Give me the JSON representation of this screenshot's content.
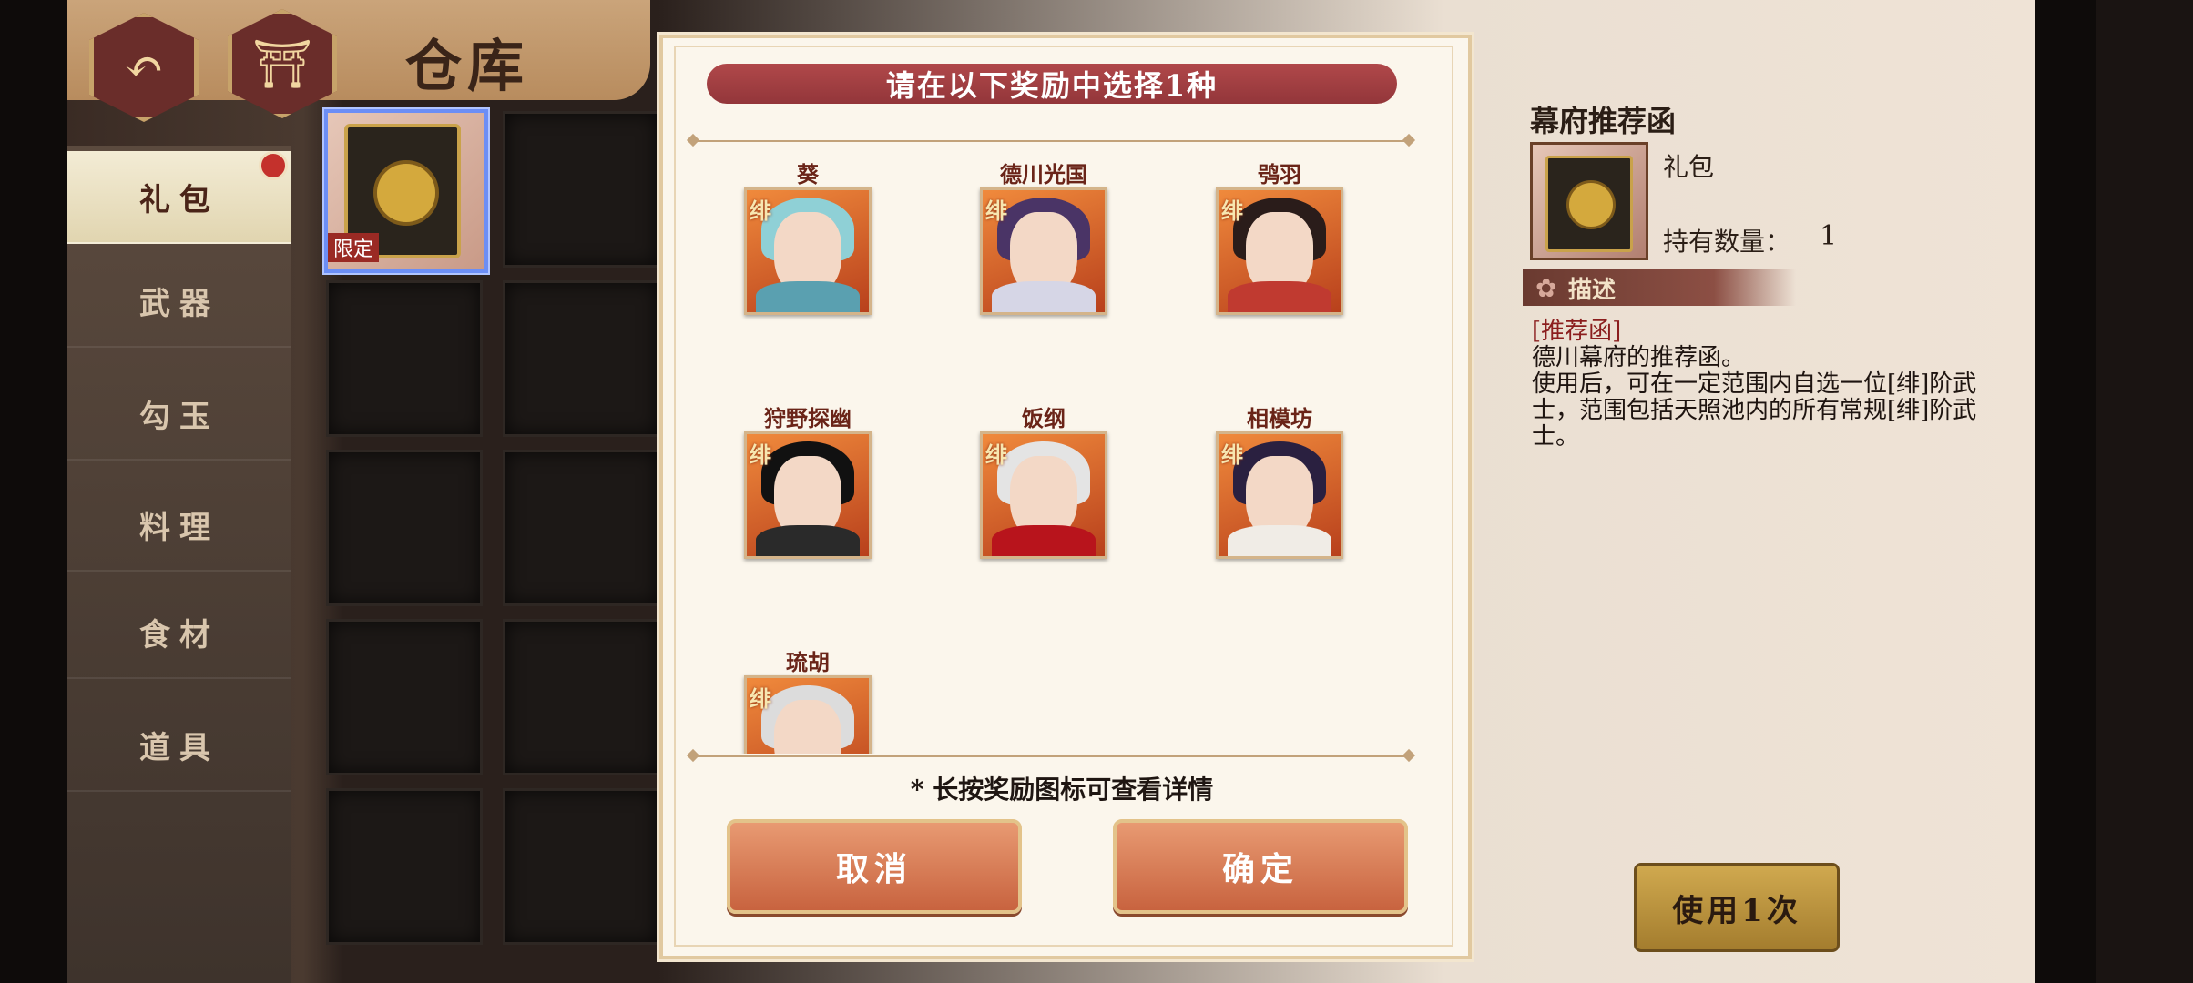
{
  "header": {
    "title": "仓库"
  },
  "sidebar": {
    "items": [
      {
        "label": "礼包",
        "active": true
      },
      {
        "label": "武器"
      },
      {
        "label": "勾玉"
      },
      {
        "label": "料理"
      },
      {
        "label": "食材"
      },
      {
        "label": "道具"
      }
    ]
  },
  "inventory": {
    "selected_item_tag": "限定"
  },
  "detail": {
    "name": "幕府推荐函",
    "type": "礼包",
    "count_label": "持有数量：",
    "count_value": "1",
    "desc_label": "描述",
    "desc_tag": "[推荐函]",
    "desc_line1": "德川幕府的推荐函。",
    "desc_line2": "使用后，可在一定范围内自选一位[绯]阶武士，范围包括天照池内的所有常规[绯]阶武士。",
    "use_button": "使用1次"
  },
  "modal": {
    "title": "请在以下奖励中选择1种",
    "rarity_mark": "绯",
    "choices": [
      {
        "name": "葵",
        "hair": "#8fd0d6",
        "body": "#5aa0b0"
      },
      {
        "name": "德川光国",
        "hair": "#4a3466",
        "body": "#d6d6e6"
      },
      {
        "name": "鸮羽",
        "hair": "#2a1c1a",
        "body": "#c03a30"
      },
      {
        "name": "狩野探幽",
        "hair": "#111111",
        "body": "#2a2a2a"
      },
      {
        "name": "饭纲",
        "hair": "#e4e4e4",
        "body": "#b8141c"
      },
      {
        "name": "相模坊",
        "hair": "#2a2040",
        "body": "#f0ece6"
      },
      {
        "name": "琉胡",
        "hair": "#dcdcdc",
        "body": "#8a9aa8"
      }
    ],
    "hint": "* 长按奖励图标可查看详情",
    "cancel": "取消",
    "confirm": "确定"
  }
}
